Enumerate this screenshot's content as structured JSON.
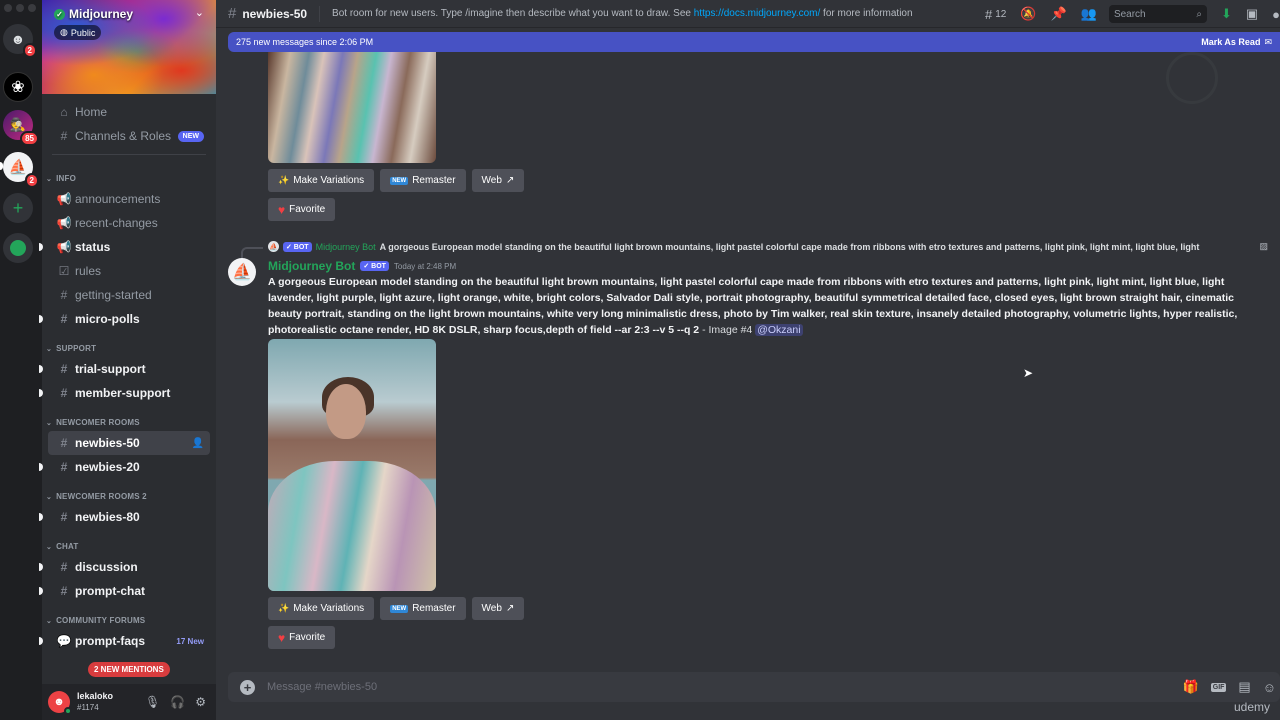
{
  "rail": {
    "home_badge": "2",
    "servers": [
      {
        "name": "ChatGPT server",
        "badge": ""
      },
      {
        "name": "Incognito server",
        "badge": "85"
      },
      {
        "name": "Midjourney server",
        "badge": "2"
      }
    ],
    "add_icon": "+",
    "explore_icon": "compass"
  },
  "server": {
    "name": "Midjourney",
    "visibility": "Public",
    "nav": [
      {
        "label": "Home",
        "icon": "home-icon"
      },
      {
        "label": "Channels & Roles",
        "icon": "channels-roles-icon",
        "tag": "NEW"
      }
    ],
    "categories": [
      {
        "name": "INFO",
        "channels": [
          {
            "label": "announcements",
            "icon": "megaphone",
            "unread": false
          },
          {
            "label": "recent-changes",
            "icon": "megaphone",
            "unread": false
          },
          {
            "label": "status",
            "icon": "megaphone",
            "unread": true
          },
          {
            "label": "rules",
            "icon": "checkbox",
            "unread": false
          },
          {
            "label": "getting-started",
            "icon": "hash",
            "unread": false
          },
          {
            "label": "micro-polls",
            "icon": "hash-thread",
            "unread": true
          }
        ]
      },
      {
        "name": "SUPPORT",
        "channels": [
          {
            "label": "trial-support",
            "icon": "hash",
            "unread": true
          },
          {
            "label": "member-support",
            "icon": "hash-thread",
            "unread": true
          }
        ]
      },
      {
        "name": "NEWCOMER ROOMS",
        "channels": [
          {
            "label": "newbies-50",
            "icon": "hash-thread",
            "active": true
          },
          {
            "label": "newbies-20",
            "icon": "hash-thread",
            "unread": true
          }
        ]
      },
      {
        "name": "NEWCOMER ROOMS 2",
        "channels": [
          {
            "label": "newbies-80",
            "icon": "hash-thread",
            "unread": true
          }
        ]
      },
      {
        "name": "CHAT",
        "channels": [
          {
            "label": "discussion",
            "icon": "hash",
            "unread": true
          },
          {
            "label": "prompt-chat",
            "icon": "hash-thread",
            "unread": true
          }
        ]
      },
      {
        "name": "COMMUNITY FORUMS",
        "channels": [
          {
            "label": "prompt-faqs",
            "icon": "forum",
            "unread": true,
            "new_count": "17 New"
          }
        ]
      }
    ],
    "mentions_pill": "2 NEW MENTIONS"
  },
  "user": {
    "name": "lekaloko",
    "tag": "#1174"
  },
  "channel": {
    "name": "newbies-50",
    "topic_prefix": "Bot room for new users. Type /imagine then describe what you want to draw. See ",
    "topic_link": "https://docs.midjourney.com/",
    "topic_suffix": " for more information",
    "thread_count": "12",
    "search_placeholder": "Search"
  },
  "newbar": {
    "text": "275 new messages since 2:06 PM",
    "mark_read": "Mark As Read"
  },
  "buttons": {
    "variations": "Make Variations",
    "remaster": "Remaster",
    "web": "Web",
    "favorite": "Favorite",
    "new_tag": "NEW"
  },
  "message": {
    "reply_bot_tag": "✓ BOT",
    "reply_author": "Midjourney Bot",
    "reply_text": "A gorgeous European model standing on the beautiful light brown mountains, light pastel colorful cape made from ribbons with etro textures and patterns, light pink, light mint, light blue, light",
    "author": "Midjourney Bot",
    "bot_tag": "✓ BOT",
    "timestamp": "Today at 2:48 PM",
    "prompt": "A gorgeous European model standing on the beautiful light brown mountains, light pastel colorful cape made from ribbons with etro textures and patterns, light pink, light mint, light blue, light lavender, light purple, light azure, light orange, white, bright colors, Salvador Dali style, portrait photography, beautiful symmetrical detailed face, closed eyes, light brown straight hair, cinematic beauty portrait, standing on the light brown mountains, white very long minimalistic dress, photo by Tim walker, real skin texture, insanely detailed photography, volumetric lights, hyper realistic, photorealistic octane render, HD 8K DSLR, sharp focus,depth of field --ar 2:3 --v 5 --q 2",
    "suffix": " - Image #4 ",
    "mention": "@Okzani"
  },
  "composer": {
    "placeholder": "Message #newbies-50"
  },
  "watermark": "udemy"
}
